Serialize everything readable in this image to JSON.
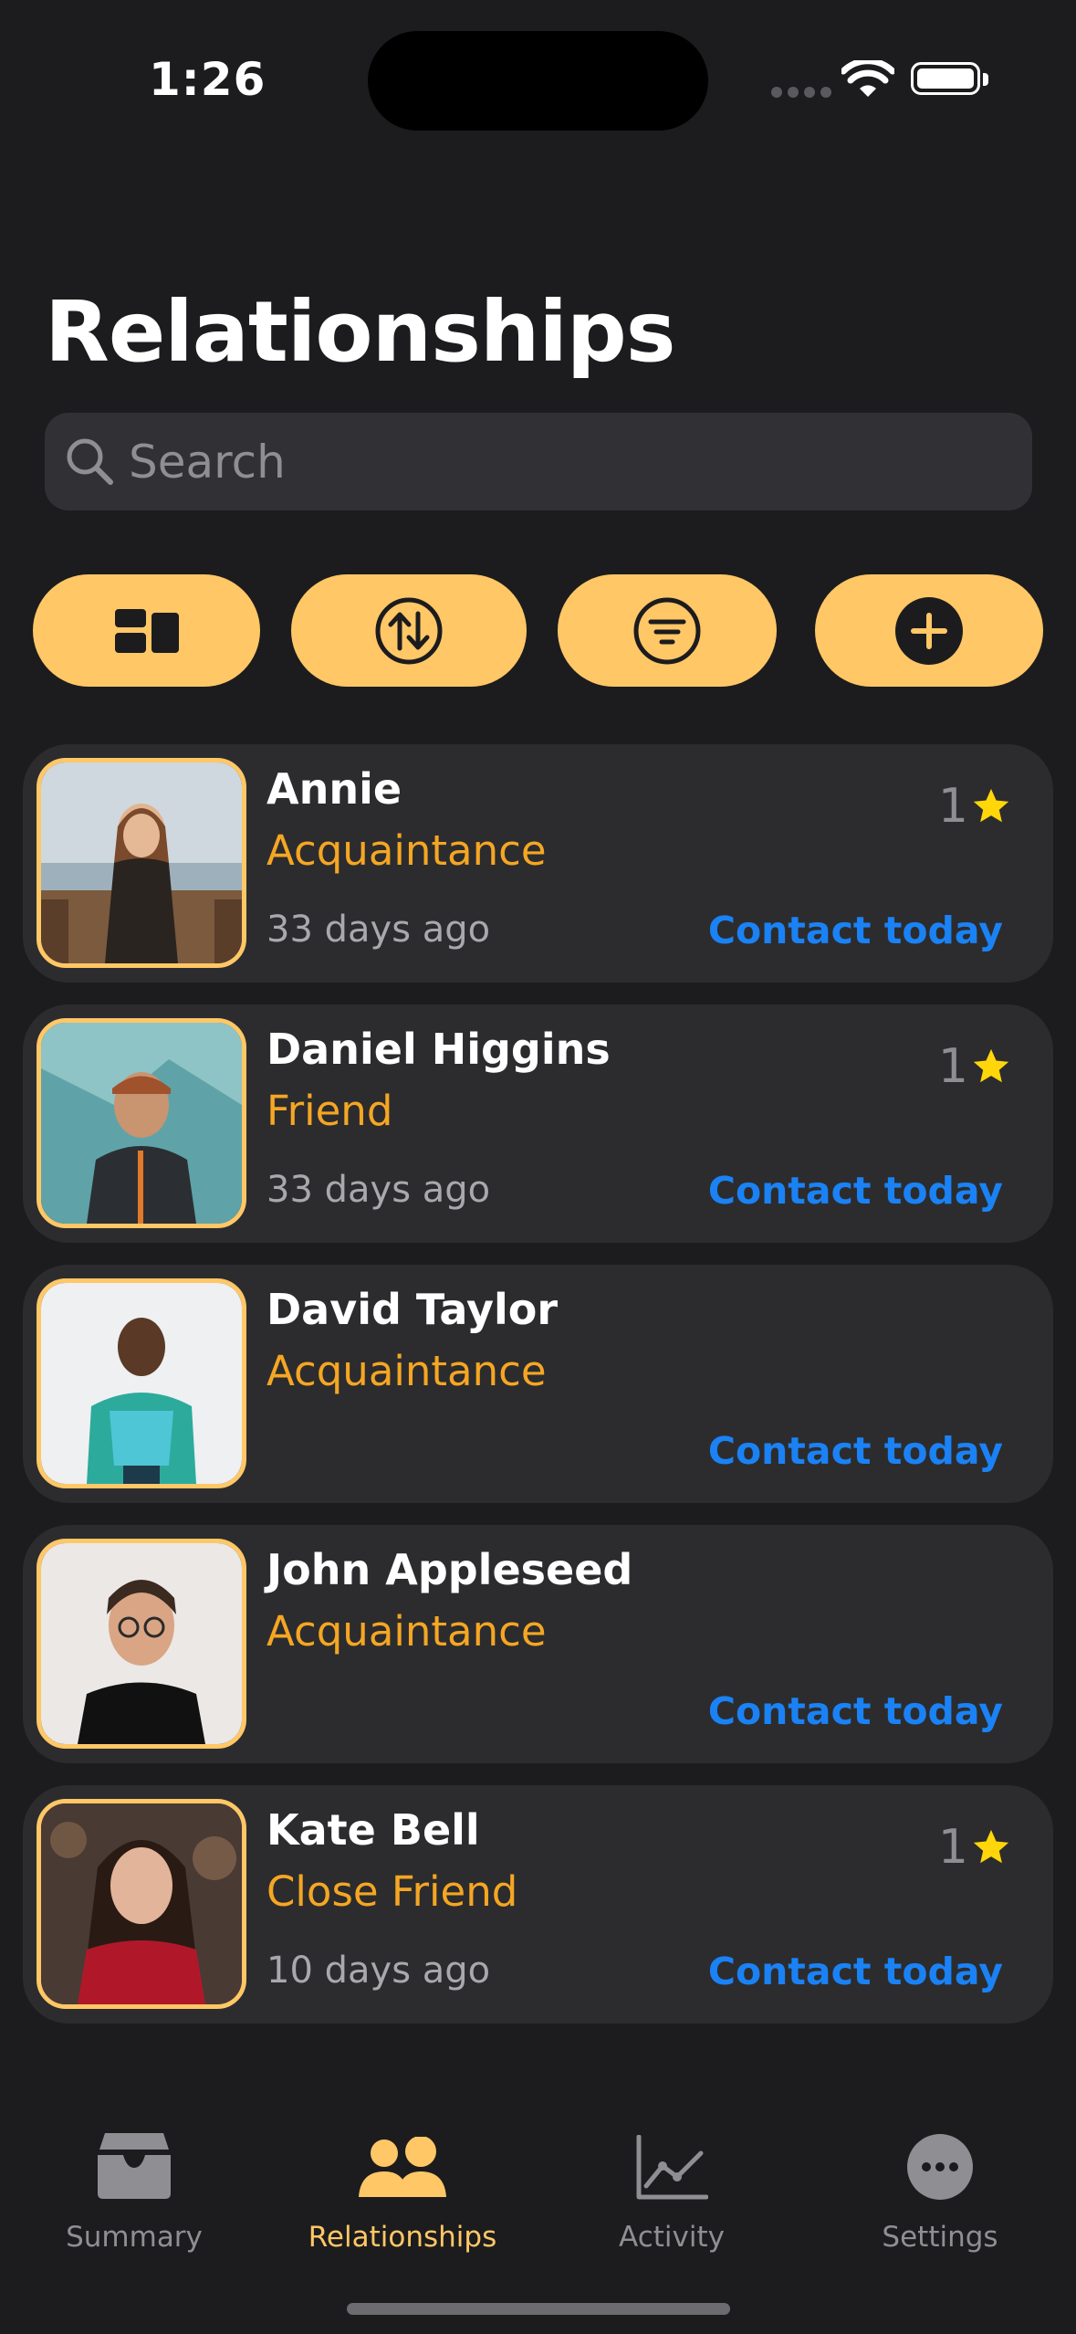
{
  "status_bar": {
    "time": "1:26"
  },
  "header": {
    "title": "Relationships"
  },
  "search": {
    "placeholder": "Search",
    "value": ""
  },
  "toolbar": {
    "buttons": [
      {
        "name": "layout",
        "icon": "layout-grid-icon"
      },
      {
        "name": "sort",
        "icon": "sort-arrows-icon"
      },
      {
        "name": "filter",
        "icon": "filter-lines-icon"
      },
      {
        "name": "add",
        "icon": "plus-circle-icon"
      }
    ]
  },
  "contacts": [
    {
      "name": "Annie",
      "relationship": "Acquaintance",
      "last_contact": "33 days ago",
      "action": "Contact today",
      "rating": "1"
    },
    {
      "name": "Daniel Higgins",
      "relationship": "Friend",
      "last_contact": "33 days ago",
      "action": "Contact today",
      "rating": "1"
    },
    {
      "name": "David Taylor",
      "relationship": "Acquaintance",
      "last_contact": "",
      "action": "Contact today",
      "rating": ""
    },
    {
      "name": "John Appleseed",
      "relationship": "Acquaintance",
      "last_contact": "",
      "action": "Contact today",
      "rating": ""
    },
    {
      "name": "Kate Bell",
      "relationship": "Close Friend",
      "last_contact": "10 days ago",
      "action": "Contact today",
      "rating": "1"
    }
  ],
  "tab_bar": {
    "tabs": [
      {
        "label": "Summary",
        "icon": "tray-icon",
        "active": false
      },
      {
        "label": "Relationships",
        "icon": "people-icon",
        "active": true
      },
      {
        "label": "Activity",
        "icon": "line-chart-icon",
        "active": false
      },
      {
        "label": "Settings",
        "icon": "ellipsis-circle-icon",
        "active": false
      }
    ]
  },
  "colors": {
    "background": "#1c1c1e",
    "card": "#2c2c2e",
    "accent": "#ffc766",
    "relationship_text": "#f5a623",
    "link": "#1a82f5",
    "star": "#ffd60a",
    "inactive": "#8e8e93"
  }
}
